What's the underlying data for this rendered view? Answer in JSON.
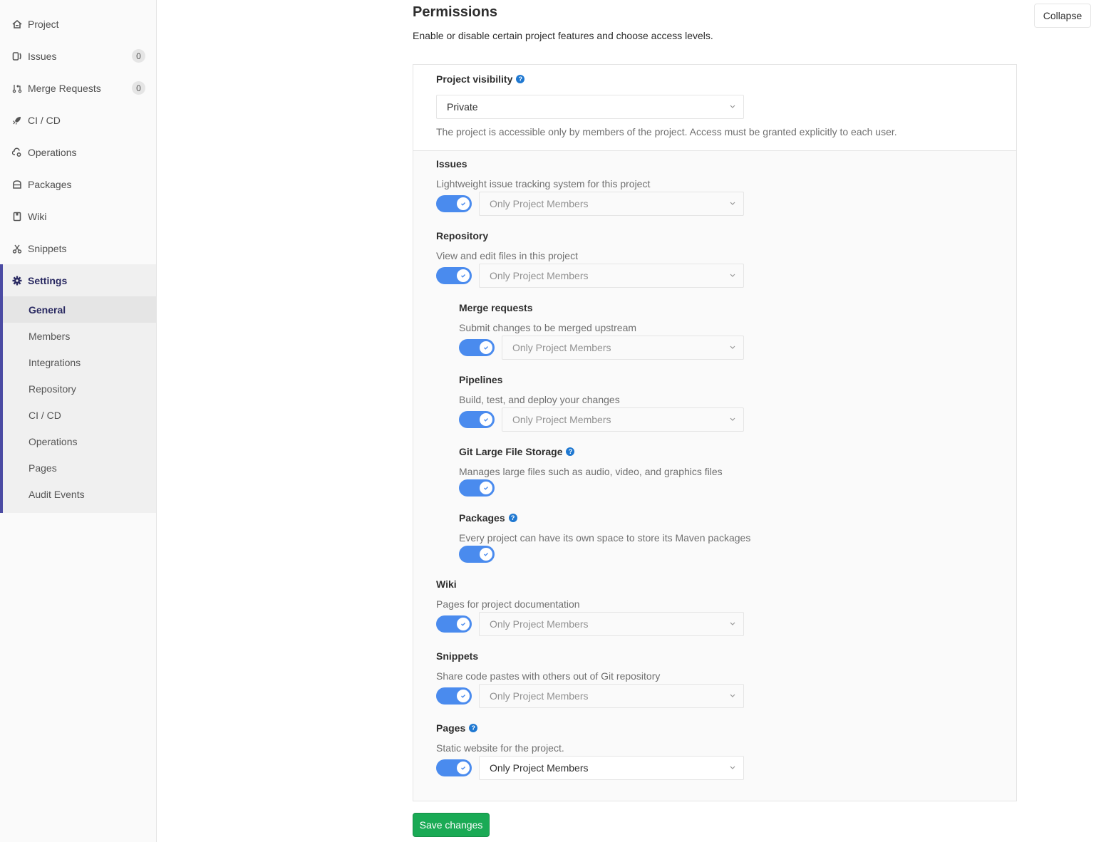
{
  "sidebar": {
    "items": [
      {
        "label": "Project",
        "icon": "home-icon"
      },
      {
        "label": "Issues",
        "icon": "issues-icon",
        "badge": "0"
      },
      {
        "label": "Merge Requests",
        "icon": "merge-request-icon",
        "badge": "0"
      },
      {
        "label": "CI / CD",
        "icon": "rocket-icon"
      },
      {
        "label": "Operations",
        "icon": "cloud-gear-icon"
      },
      {
        "label": "Packages",
        "icon": "package-icon"
      },
      {
        "label": "Wiki",
        "icon": "book-icon"
      },
      {
        "label": "Snippets",
        "icon": "scissors-icon"
      }
    ],
    "settings": {
      "label": "Settings",
      "icon": "gear-icon",
      "subitems": [
        "General",
        "Members",
        "Integrations",
        "Repository",
        "CI / CD",
        "Operations",
        "Pages",
        "Audit Events"
      ],
      "active": "General"
    }
  },
  "header": {
    "title": "Permissions",
    "description": "Enable or disable certain project features and choose access levels.",
    "collapse_label": "Collapse"
  },
  "visibility": {
    "label": "Project visibility",
    "value": "Private",
    "hint": "The project is accessible only by members of the project. Access must be granted explicitly to each user."
  },
  "features": [
    {
      "name": "Issues",
      "desc": "Lightweight issue tracking system for this project",
      "enabled": true,
      "access": "Only Project Members",
      "help": false
    },
    {
      "name": "Repository",
      "desc": "View and edit files in this project",
      "enabled": true,
      "access": "Only Project Members",
      "help": false
    },
    {
      "name": "Merge requests",
      "desc": "Submit changes to be merged upstream",
      "enabled": true,
      "access": "Only Project Members",
      "help": false
    },
    {
      "name": "Pipelines",
      "desc": "Build, test, and deploy your changes",
      "enabled": true,
      "access": "Only Project Members",
      "help": false
    },
    {
      "name": "Git Large File Storage",
      "desc": "Manages large files such as audio, video, and graphics files",
      "enabled": true,
      "help": true
    },
    {
      "name": "Packages",
      "desc": "Every project can have its own space to store its Maven packages",
      "enabled": true,
      "help": true
    },
    {
      "name": "Wiki",
      "desc": "Pages for project documentation",
      "enabled": true,
      "access": "Only Project Members",
      "help": false
    },
    {
      "name": "Snippets",
      "desc": "Share code pastes with others out of Git repository",
      "enabled": true,
      "access": "Only Project Members",
      "help": false
    },
    {
      "name": "Pages",
      "desc": "Static website for the project.",
      "enabled": true,
      "access": "Only Project Members",
      "help": true
    }
  ],
  "colors": {
    "accent": "#4b4ba3",
    "toggle": "#4a8bee",
    "save": "#1aaa55",
    "help": "#1f78d1"
  },
  "save_label": "Save changes"
}
